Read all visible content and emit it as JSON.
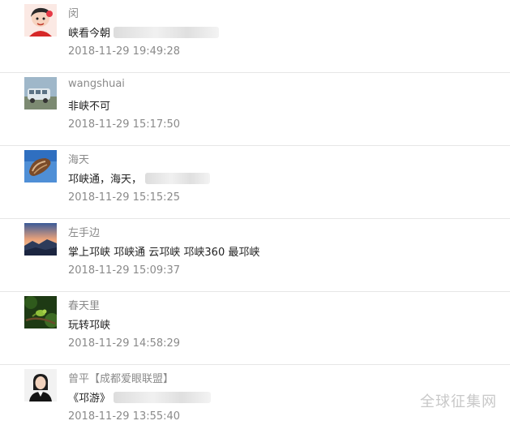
{
  "comments": [
    {
      "username": "闵",
      "content": "峡看今朝",
      "timestamp": "2018-11-29 19:49:28",
      "avatar_icon": "cartoon-face-avatar",
      "has_blur": true
    },
    {
      "username": "wangshuai",
      "content": "非峡不可",
      "timestamp": "2018-11-29 15:17:50",
      "avatar_icon": "van-photo-avatar",
      "has_blur": false
    },
    {
      "username": "海天",
      "content": "邛峡通，海天，",
      "timestamp": "2018-11-29 15:15:25",
      "avatar_icon": "shell-photo-avatar",
      "has_blur": true
    },
    {
      "username": "左手边",
      "content": "掌上邛峡 邛峡通 云邛峡 邛峡360 最邛峡",
      "timestamp": "2018-11-29 15:09:37",
      "avatar_icon": "sunset-landscape-avatar",
      "has_blur": false
    },
    {
      "username": "春天里",
      "content": "玩转邛峡",
      "timestamp": "2018-11-29 14:58:29",
      "avatar_icon": "bird-branch-avatar",
      "has_blur": false
    },
    {
      "username": "曾平【成都爱眼联盟】",
      "content": "《邛游》",
      "timestamp": "2018-11-29 13:55:40",
      "avatar_icon": "woman-portrait-avatar",
      "has_blur": true
    }
  ],
  "watermark": "全球征集网"
}
